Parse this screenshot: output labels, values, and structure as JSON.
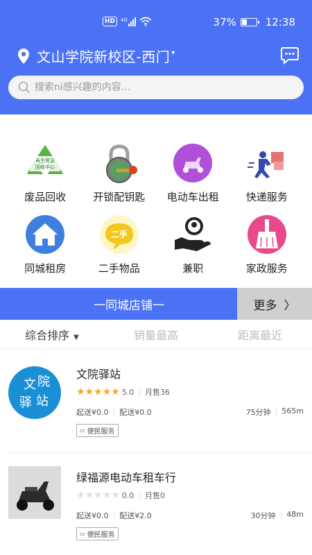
{
  "status_bar": {
    "network": "HD",
    "signal": "4G",
    "battery_percent_label": "37%",
    "battery_level": 0.37,
    "time": "12:38"
  },
  "header": {
    "location": "文山学院新校区-西门",
    "search_placeholder": "搜索ni感兴趣的内容...",
    "brand_color": "#4b72f4"
  },
  "categories": [
    {
      "label": "废品回收",
      "icon": "recycle-icon",
      "icon_text": "再生资源 回收中心"
    },
    {
      "label": "开锁配钥匙",
      "icon": "padlock-key-icon"
    },
    {
      "label": "电动车出租",
      "icon": "scooter-icon"
    },
    {
      "label": "快递服务",
      "icon": "courier-icon"
    },
    {
      "label": "同城租房",
      "icon": "house-icon"
    },
    {
      "label": "二手物品",
      "icon": "second-hand-bubble-icon",
      "icon_text": "二手"
    },
    {
      "label": "兼职",
      "icon": "hand-person-icon"
    },
    {
      "label": "家政服务",
      "icon": "broom-icon"
    }
  ],
  "banner": {
    "title": "一同城店铺一",
    "more_label": "更多",
    "more_icon": "chevron-right-icon"
  },
  "sort": {
    "options": [
      "综合排序",
      "销量最高",
      "距离最近"
    ],
    "active": 0
  },
  "shops": [
    {
      "name": "文院驿站",
      "logo_text": "文 院 驿 站",
      "rating": 5.0,
      "rating_label": "5.0",
      "sales": "月售36",
      "min_order": "起送¥0.0",
      "delivery_fee": "配送¥0.0",
      "time": "75分钟",
      "distance": "565m",
      "tag": "便民服务"
    },
    {
      "name": "绿福源电动车租车行",
      "logo_text": "",
      "rating": 0.0,
      "rating_label": "0.0",
      "sales": "月售0",
      "min_order": "起送¥0.0",
      "delivery_fee": "配送¥2.0",
      "time": "30分钟",
      "distance": "48m",
      "tag": "便民服务"
    }
  ]
}
